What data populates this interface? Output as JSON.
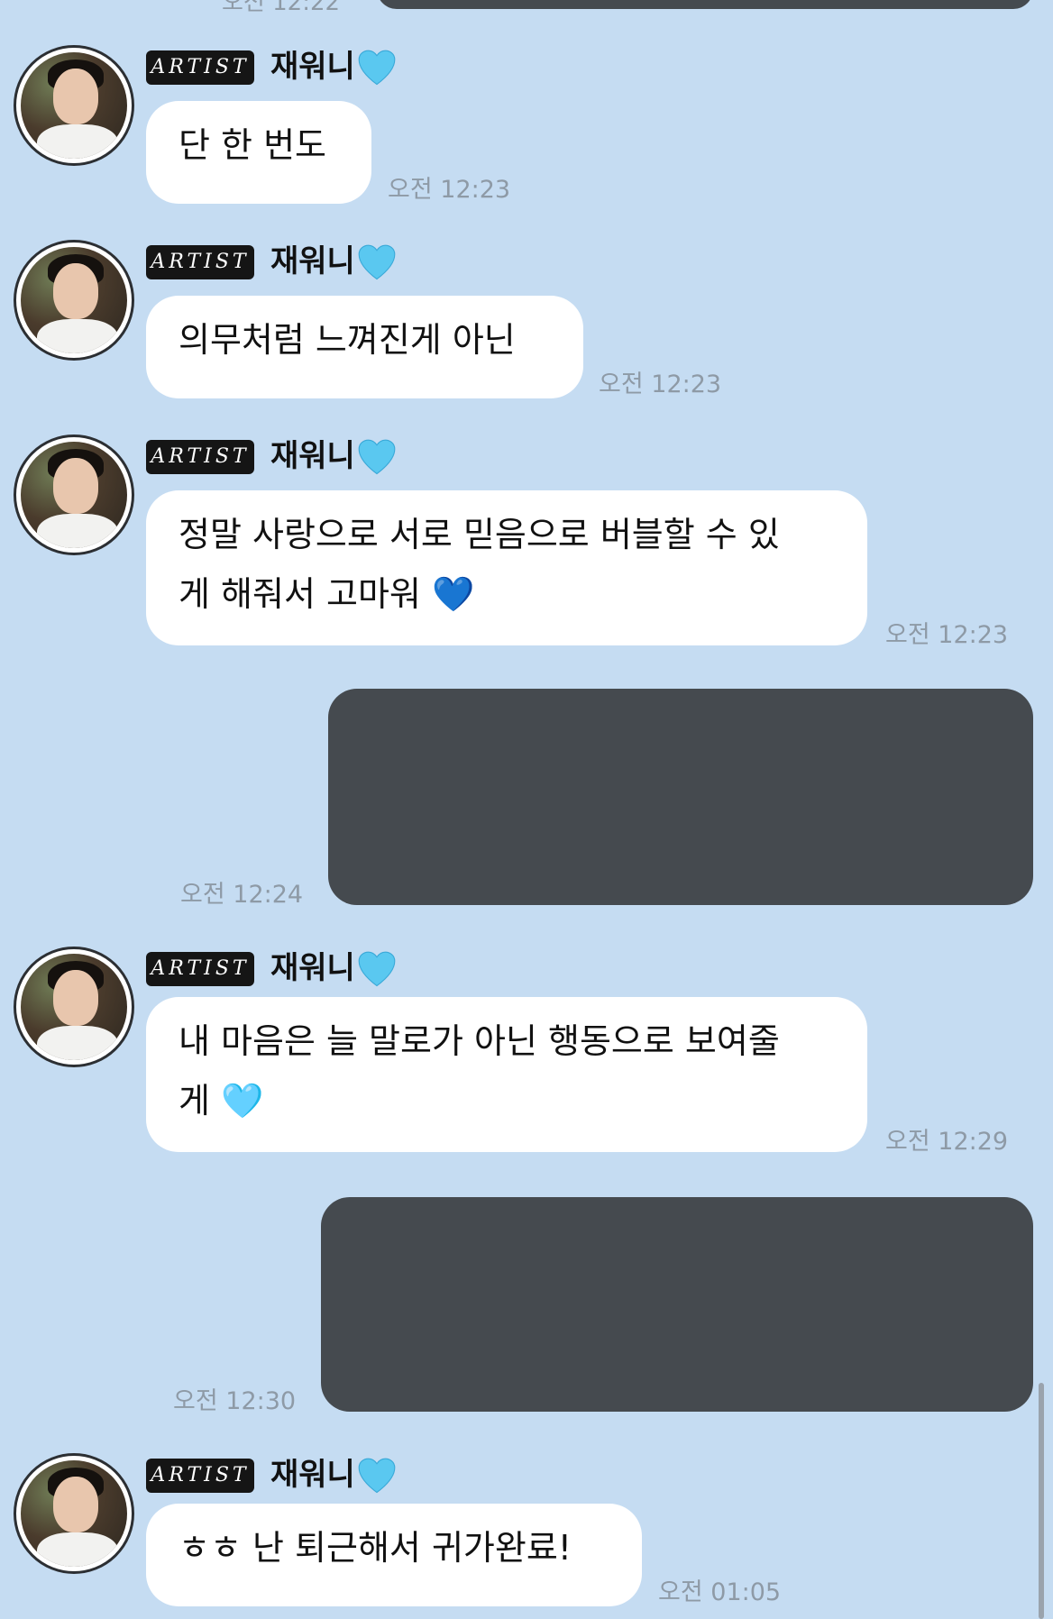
{
  "top": {
    "time": "오전 12:22"
  },
  "messages": [
    {
      "type": "artist",
      "badge": "ARTIST",
      "sender": "재워니",
      "text": "단 한 번도",
      "time": "오전 12:23",
      "heart": "light-blue-heart"
    },
    {
      "type": "artist",
      "badge": "ARTIST",
      "sender": "재워니",
      "text": "의무처럼 느껴진게 아닌",
      "time": "오전 12:23",
      "heart": "light-blue-heart"
    },
    {
      "type": "artist",
      "badge": "ARTIST",
      "sender": "재워니",
      "text": "정말 사랑으로 서로 믿음으로 버블할 수 있\n게 해줘서 고마워 💙",
      "time": "오전 12:23",
      "heart": "light-blue-heart"
    },
    {
      "type": "self-redacted",
      "time": "오전 12:24"
    },
    {
      "type": "artist",
      "badge": "ARTIST",
      "sender": "재워니",
      "text": "내 마음은 늘 말로가 아닌 행동으로 보여줄\n게 🩵",
      "time": "오전 12:29",
      "heart": "light-blue-heart"
    },
    {
      "type": "self-redacted",
      "time": "오전 12:30"
    },
    {
      "type": "artist",
      "badge": "ARTIST",
      "sender": "재워니",
      "text": "ㅎㅎ 난 퇴근해서 귀가완료!",
      "time": "오전 01:05",
      "heart": "light-blue-heart"
    }
  ],
  "colors": {
    "background": "#c5dcf2",
    "bubble": "#ffffff",
    "redacted": "#454a4f",
    "heart": "#5ac8f0",
    "time": "#8e9aa6"
  }
}
